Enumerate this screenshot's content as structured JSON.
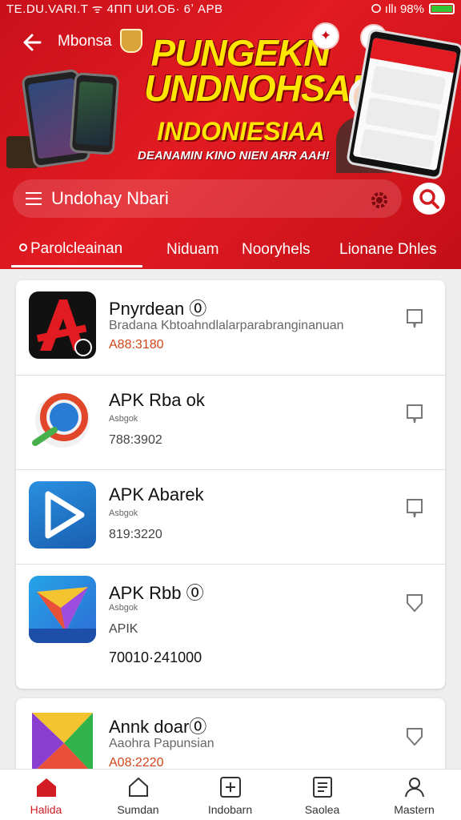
{
  "status_bar": {
    "left_text": "TЕ.DU.VARI.T  ᯤ  4ПП  UИ.ОБ·  6ʼ  APB",
    "right_text": "ⵔ  ıllı  98%"
  },
  "header": {
    "app_name": "Mbonsa",
    "banner": {
      "title": "PUNGEKN UNDNOHSAN",
      "subtitle": "INDONIESIAA",
      "tagline": "DEANAMIN KINO NIEN ARR AAH!"
    }
  },
  "search": {
    "text": "Undohay Nbari"
  },
  "tabs": [
    {
      "label": "Parolcleainan",
      "active": true
    },
    {
      "label": "Niduam",
      "active": false
    },
    {
      "label": "Nooryhels",
      "active": false
    },
    {
      "label": "Lionane Dhles",
      "active": false
    }
  ],
  "apps": [
    {
      "title": "Pnyrdean ⓪",
      "subtitle": "Bradana Kbtoahndlalarparabranginanuan",
      "meta": "A88:3180",
      "meta_color": "#d0461a",
      "icon": "red-a-app-icon"
    },
    {
      "title": "APK Rba ok",
      "subtitle": "ᴬˢᵇᵍᵒᵏ",
      "meta": "788:3902",
      "meta_color": "#444444",
      "icon": "ring-app-icon"
    },
    {
      "title": "APK Abarek",
      "subtitle": "ᴬˢᵇᵍᵒᵏ",
      "meta": "819:3220",
      "meta_color": "#444444",
      "icon": "play-app-icon"
    },
    {
      "title": "APK Rbb ⓪",
      "subtitle": "ᴬˢᵇᵍᵒᵏ",
      "meta": "APIK",
      "meta_color": "#444444",
      "extra": "70010·241000",
      "icon": "paper-plane-app-icon"
    },
    {
      "title": "Annk doar⓪",
      "subtitle": "Aaohra Papunsian",
      "meta": "A08:2220",
      "meta_color": "#d0461a",
      "icon": "store-app-icon"
    }
  ],
  "bottom_nav": [
    {
      "label": "Halida",
      "icon": "home-icon",
      "active": true
    },
    {
      "label": "Sumdan",
      "icon": "house-outline-icon",
      "active": false
    },
    {
      "label": "Indobarn",
      "icon": "add-box-icon",
      "active": false
    },
    {
      "label": "Saolea",
      "icon": "list-icon",
      "active": false
    },
    {
      "label": "Mastern",
      "icon": "profile-icon",
      "active": false
    }
  ],
  "colors": {
    "brand_red": "#e21b22",
    "banner_yellow": "#ffe600",
    "accent_orange": "#d0461a",
    "background": "#eeeeee"
  }
}
